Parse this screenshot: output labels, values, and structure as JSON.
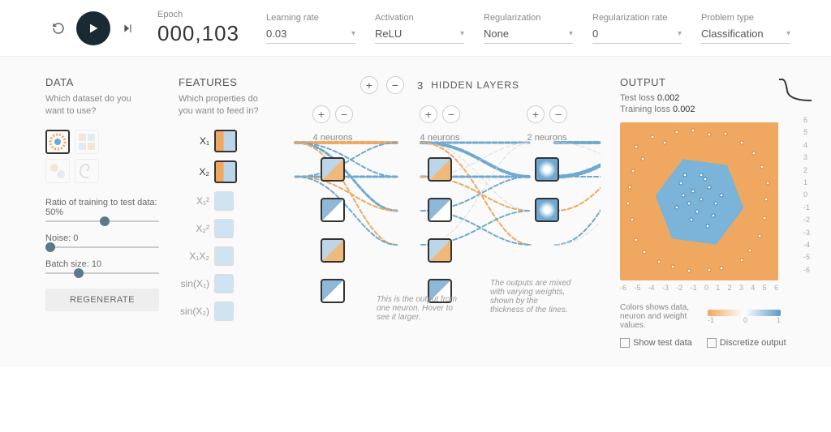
{
  "topbar": {
    "epoch_label": "Epoch",
    "epoch_value": "000,103",
    "lr_label": "Learning rate",
    "lr_value": "0.03",
    "activation_label": "Activation",
    "activation_value": "ReLU",
    "reg_label": "Regularization",
    "reg_value": "None",
    "regrate_label": "Regularization rate",
    "regrate_value": "0",
    "problem_label": "Problem type",
    "problem_value": "Classification"
  },
  "data_panel": {
    "title": "DATA",
    "subtitle": "Which dataset do you want to use?",
    "ratio_label": "Ratio of training to test data:  50%",
    "ratio_pct": 50,
    "noise_label": "Noise:  0",
    "noise_val": 0,
    "batch_label": "Batch size:  10",
    "batch_val": 10,
    "regenerate": "REGENERATE"
  },
  "features_panel": {
    "title": "FEATURES",
    "subtitle": "Which properties do you want to feed in?",
    "items": [
      {
        "label": "X₁",
        "active": true
      },
      {
        "label": "X₂",
        "active": true
      },
      {
        "label": "X₁²",
        "active": false
      },
      {
        "label": "X₂²",
        "active": false
      },
      {
        "label": "X₁X₂",
        "active": false
      },
      {
        "label": "sin(X₁)",
        "active": false
      },
      {
        "label": "sin(X₂)",
        "active": false
      }
    ]
  },
  "network": {
    "layer_count_label": "3",
    "layer_title": "HIDDEN LAYERS",
    "layers": [
      {
        "neurons_label": "4 neurons",
        "count": 4
      },
      {
        "neurons_label": "4 neurons",
        "count": 4
      },
      {
        "neurons_label": "2 neurons",
        "count": 2
      }
    ],
    "note_neuron": "This is the output from one neuron. Hover to see it larger.",
    "note_weights": "The outputs are mixed with varying weights, shown by the thickness of the lines."
  },
  "output": {
    "title": "OUTPUT",
    "test_loss_label": "Test loss",
    "test_loss_value": "0.002",
    "train_loss_label": "Training loss",
    "train_loss_value": "0.002",
    "axis_ticks": [
      "-6",
      "-5",
      "-4",
      "-3",
      "-2",
      "-1",
      "0",
      "1",
      "2",
      "3",
      "4",
      "5",
      "6"
    ],
    "legend_text": "Colors shows data, neuron and weight values.",
    "legend_min": "-1",
    "legend_mid": "0",
    "legend_max": "1",
    "show_test": "Show test data",
    "discretize": "Discretize output"
  }
}
